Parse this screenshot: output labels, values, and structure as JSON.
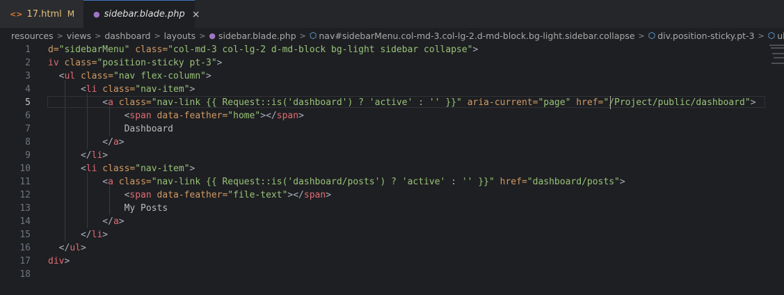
{
  "tabs": [
    {
      "name": "17.html",
      "icon": "html-code-icon",
      "badge": "M"
    },
    {
      "name": "sidebar.blade.php",
      "icon": "php-elephant-icon",
      "close": "×"
    }
  ],
  "breadcrumb": {
    "items": [
      "resources",
      "views",
      "dashboard",
      "layouts",
      "sidebar.blade.php",
      "nav#sidebarMenu.col-md-3.col-lg-2.d-md-block.bg-light.sidebar.collapse",
      "div.position-sticky.pt-3",
      "ul.nav.flex-colu"
    ],
    "separator": ">"
  },
  "editor": {
    "current_line": 5,
    "lines": [
      {
        "n": "1",
        "seg": [
          {
            "c": "t-attr",
            "t": "d="
          },
          {
            "c": "t-str",
            "t": "\"sidebarMenu\""
          },
          {
            "c": "t-txt",
            "t": " "
          },
          {
            "c": "t-attr",
            "t": "class="
          },
          {
            "c": "t-str",
            "t": "\"col-md-3 col-lg-2 d-md-block bg-light sidebar collapse\""
          },
          {
            "c": "t-brk",
            "t": ">"
          }
        ]
      },
      {
        "n": "2",
        "seg": [
          {
            "c": "t-tag",
            "t": "iv"
          },
          {
            "c": "t-txt",
            "t": " "
          },
          {
            "c": "t-attr",
            "t": "class="
          },
          {
            "c": "t-str",
            "t": "\"position-sticky pt-3\""
          },
          {
            "c": "t-brk",
            "t": ">"
          }
        ]
      },
      {
        "n": "3",
        "seg": [
          {
            "c": "t-txt",
            "t": "  "
          },
          {
            "c": "t-brk",
            "t": "<"
          },
          {
            "c": "t-tag",
            "t": "ul"
          },
          {
            "c": "t-txt",
            "t": " "
          },
          {
            "c": "t-attr",
            "t": "class="
          },
          {
            "c": "t-str",
            "t": "\"nav flex-column\""
          },
          {
            "c": "t-brk",
            "t": ">"
          }
        ]
      },
      {
        "n": "4",
        "seg": [
          {
            "c": "t-txt",
            "t": "      "
          },
          {
            "c": "t-brk",
            "t": "<"
          },
          {
            "c": "t-tag",
            "t": "li"
          },
          {
            "c": "t-txt",
            "t": " "
          },
          {
            "c": "t-attr",
            "t": "class="
          },
          {
            "c": "t-str",
            "t": "\"nav-item\""
          },
          {
            "c": "t-brk",
            "t": ">"
          }
        ]
      },
      {
        "n": "5",
        "seg": [
          {
            "c": "t-txt",
            "t": "          "
          },
          {
            "c": "t-brk",
            "t": "<"
          },
          {
            "c": "t-tag",
            "t": "a"
          },
          {
            "c": "t-txt",
            "t": " "
          },
          {
            "c": "t-attr",
            "t": "class="
          },
          {
            "c": "t-str",
            "t": "\"nav-link {{ Request::is('dashboard') ? 'active' : '' }}\""
          },
          {
            "c": "t-txt",
            "t": " "
          },
          {
            "c": "t-attr",
            "t": "aria-current="
          },
          {
            "c": "t-str",
            "t": "\"page\""
          },
          {
            "c": "t-txt",
            "t": " "
          },
          {
            "c": "t-attr",
            "t": "href="
          },
          {
            "c": "t-str",
            "t": "\"/Project/public/dashboard\""
          },
          {
            "c": "t-brk",
            "t": ">"
          }
        ]
      },
      {
        "n": "6",
        "seg": [
          {
            "c": "t-txt",
            "t": "              "
          },
          {
            "c": "t-brk",
            "t": "<"
          },
          {
            "c": "t-tag",
            "t": "span"
          },
          {
            "c": "t-txt",
            "t": " "
          },
          {
            "c": "t-attr",
            "t": "data-feather="
          },
          {
            "c": "t-str",
            "t": "\"home\""
          },
          {
            "c": "t-brk",
            "t": "></"
          },
          {
            "c": "t-tag",
            "t": "span"
          },
          {
            "c": "t-brk",
            "t": ">"
          }
        ]
      },
      {
        "n": "7",
        "seg": [
          {
            "c": "t-txt",
            "t": "              Dashboard"
          }
        ]
      },
      {
        "n": "8",
        "seg": [
          {
            "c": "t-txt",
            "t": "          "
          },
          {
            "c": "t-brk",
            "t": "</"
          },
          {
            "c": "t-tag",
            "t": "a"
          },
          {
            "c": "t-brk",
            "t": ">"
          }
        ]
      },
      {
        "n": "9",
        "seg": [
          {
            "c": "t-txt",
            "t": "      "
          },
          {
            "c": "t-brk",
            "t": "</"
          },
          {
            "c": "t-tag",
            "t": "li"
          },
          {
            "c": "t-brk",
            "t": ">"
          }
        ]
      },
      {
        "n": "10",
        "seg": [
          {
            "c": "t-txt",
            "t": "      "
          },
          {
            "c": "t-brk",
            "t": "<"
          },
          {
            "c": "t-tag",
            "t": "li"
          },
          {
            "c": "t-txt",
            "t": " "
          },
          {
            "c": "t-attr",
            "t": "class="
          },
          {
            "c": "t-str",
            "t": "\"nav-item\""
          },
          {
            "c": "t-brk",
            "t": ">"
          }
        ]
      },
      {
        "n": "11",
        "seg": [
          {
            "c": "t-txt",
            "t": "          "
          },
          {
            "c": "t-brk",
            "t": "<"
          },
          {
            "c": "t-tag",
            "t": "a"
          },
          {
            "c": "t-txt",
            "t": " "
          },
          {
            "c": "t-attr",
            "t": "class="
          },
          {
            "c": "t-str",
            "t": "\"nav-link {{ Request::is('dashboard/posts') ? 'active' : '' }}\""
          },
          {
            "c": "t-txt",
            "t": " "
          },
          {
            "c": "t-attr",
            "t": "href="
          },
          {
            "c": "t-str",
            "t": "\"dashboard/posts\""
          },
          {
            "c": "t-brk",
            "t": ">"
          }
        ]
      },
      {
        "n": "12",
        "seg": [
          {
            "c": "t-txt",
            "t": "              "
          },
          {
            "c": "t-brk",
            "t": "<"
          },
          {
            "c": "t-tag",
            "t": "span"
          },
          {
            "c": "t-txt",
            "t": " "
          },
          {
            "c": "t-attr",
            "t": "data-feather="
          },
          {
            "c": "t-str",
            "t": "\"file-text\""
          },
          {
            "c": "t-brk",
            "t": "></"
          },
          {
            "c": "t-tag",
            "t": "span"
          },
          {
            "c": "t-brk",
            "t": ">"
          }
        ]
      },
      {
        "n": "13",
        "seg": [
          {
            "c": "t-txt",
            "t": "              My Posts"
          }
        ]
      },
      {
        "n": "14",
        "seg": [
          {
            "c": "t-txt",
            "t": "          "
          },
          {
            "c": "t-brk",
            "t": "</"
          },
          {
            "c": "t-tag",
            "t": "a"
          },
          {
            "c": "t-brk",
            "t": ">"
          }
        ]
      },
      {
        "n": "15",
        "seg": [
          {
            "c": "t-txt",
            "t": "      "
          },
          {
            "c": "t-brk",
            "t": "</"
          },
          {
            "c": "t-tag",
            "t": "li"
          },
          {
            "c": "t-brk",
            "t": ">"
          }
        ]
      },
      {
        "n": "16",
        "seg": [
          {
            "c": "t-txt",
            "t": "  "
          },
          {
            "c": "t-brk",
            "t": "</"
          },
          {
            "c": "t-tag",
            "t": "ul"
          },
          {
            "c": "t-brk",
            "t": ">"
          }
        ]
      },
      {
        "n": "17",
        "seg": [
          {
            "c": "t-tag",
            "t": "div"
          },
          {
            "c": "t-brk",
            "t": ">"
          }
        ]
      },
      {
        "n": "18",
        "seg": []
      }
    ]
  }
}
